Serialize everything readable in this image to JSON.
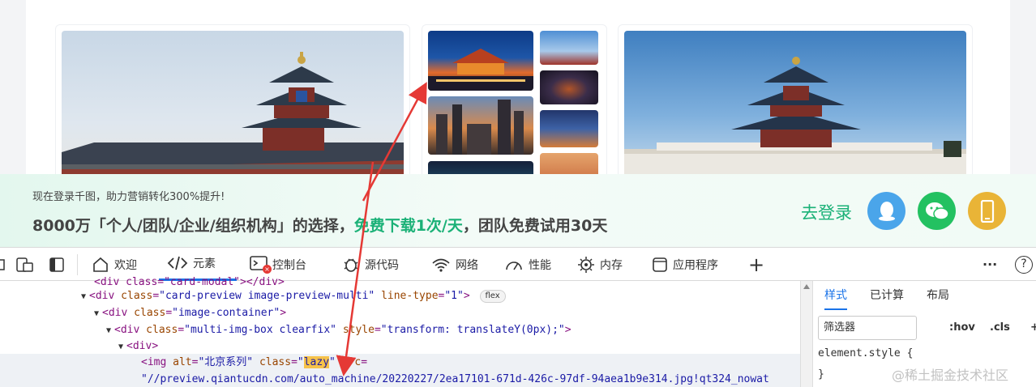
{
  "promo": {
    "subtitle": "现在登录千图，助力营销转化300%提升!",
    "main_prefix": "8000万「个人/团队/企业/组织机构」的选择，",
    "main_highlight": "免费下载1次/天",
    "main_suffix": "，团队免费试用30天",
    "login_label": "去登录"
  },
  "toolbar": {
    "tabs": [
      {
        "label": "欢迎",
        "icon": "home-icon"
      },
      {
        "label": "元素",
        "icon": "code-icon",
        "active": true
      },
      {
        "label": "控制台",
        "icon": "console-icon"
      },
      {
        "label": "源代码",
        "icon": "bug-icon"
      },
      {
        "label": "网络",
        "icon": "wifi-icon"
      },
      {
        "label": "性能",
        "icon": "gauge-icon"
      },
      {
        "label": "内存",
        "icon": "chip-icon"
      },
      {
        "label": "应用程序",
        "icon": "app-icon"
      }
    ],
    "add_label": "+",
    "more_label": "···",
    "help_label": "?"
  },
  "elements": {
    "line0": "<div class=\"card-modal\"></div>",
    "line1_tag_open": "<div",
    "line1_attr_name": "class",
    "line1_attr_value": "\"card-preview image-preview-multi\"",
    "line1_attr2_name": "line-type",
    "line1_attr2_value": "\"1\"",
    "line1_close": ">",
    "line1_badge": "flex",
    "line2_tag_open": "<div",
    "line2_attr_name": "class",
    "line2_attr_value": "\"image-container\"",
    "line2_close": ">",
    "line3_tag_open": "<div",
    "line3_attr_name": "class",
    "line3_attr_value": "\"multi-img-box clearfix\"",
    "line3_attr2_name": "style",
    "line3_attr2_value": "\"transform: translateY(0px);\"",
    "line3_close": ">",
    "line4_tag": "<div>",
    "line5_tag_open": "<img",
    "line5_attr_name": "alt",
    "line5_attr_value": "\"北京系列\"",
    "line5_attr2_name": "class",
    "line5_attr2_q1": "\"",
    "line5_attr2_value": "lazy",
    "line5_attr2_q2": "\"",
    "line5_attr3_name": "src",
    "line6_value": "\"//preview.qiantucdn.com/auto_machine/20220227/2ea17101-671d-426c-97df-94aea1b9e314.jpg!qt324_nowat"
  },
  "styles_panel": {
    "tabs": [
      "样式",
      "已计算",
      "布局"
    ],
    "filter_placeholder": "筛选器",
    "hov_label": ":hov",
    "cls_label": ".cls",
    "plus_label": "+",
    "rule_selector": "element.style {",
    "rule_close": "}"
  },
  "watermark": "@稀土掘金技术社区",
  "colors": {
    "accent_green": "#1bb177",
    "devtools_blue": "#1a73e8",
    "arrow_red": "#e53935",
    "qq_blue": "#4aa5ea",
    "wechat_green": "#23c161",
    "phone_yellow": "#e9b437"
  }
}
